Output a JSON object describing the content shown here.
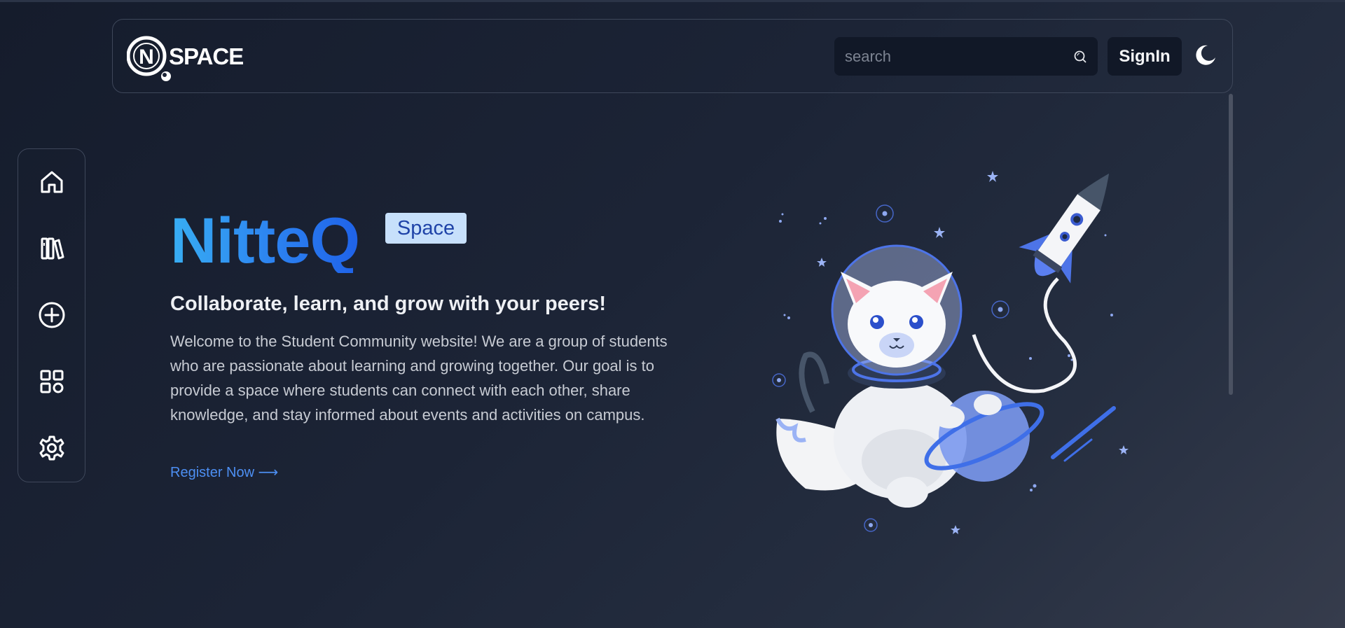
{
  "header": {
    "logo_text": "SPACE",
    "logo_mark": "N",
    "search": {
      "placeholder": "search",
      "value": ""
    },
    "signin_label": "SignIn",
    "theme_icon": "moon-icon"
  },
  "sidebar": {
    "items": [
      {
        "id": "home",
        "icon": "home-icon"
      },
      {
        "id": "library",
        "icon": "books-icon"
      },
      {
        "id": "create",
        "icon": "plus-circle-icon"
      },
      {
        "id": "apps",
        "icon": "grid-icon"
      },
      {
        "id": "settings",
        "icon": "gear-icon"
      }
    ]
  },
  "hero": {
    "title": "NitteQ",
    "badge": "Space",
    "subtitle": "Collaborate, learn, and grow with your peers!",
    "description": "Welcome to the Student Community website! We are a group of students who are passionate about learning and growing together. Our goal is to provide a space where students can connect with each other, share knowledge, and stay informed about events and activities on campus.",
    "cta_label": "Register Now ⟶"
  },
  "colors": {
    "accent": "#3b82f6",
    "badge_bg": "#c7e0fb",
    "badge_text": "#1f43a8",
    "background": "#1c2436"
  }
}
